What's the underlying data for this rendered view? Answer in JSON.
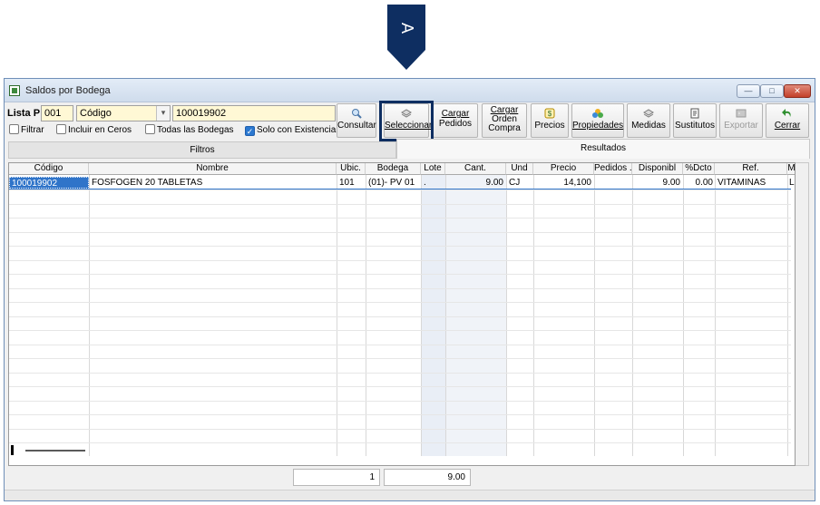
{
  "marker": {
    "letter": "A",
    "color": "#0e2e61"
  },
  "window": {
    "title": "Saldos por Bodega",
    "controls": {
      "minimize": "—",
      "maximize": "□",
      "close": "✕"
    }
  },
  "toolbar": {
    "lista_label": "Lista P:",
    "lista_value": "001",
    "criterio_value": "Código",
    "codigo_value": "100019902",
    "checkboxes": {
      "filtrar": {
        "label": "Filtrar",
        "checked": false
      },
      "incluir_ceros": {
        "label": "Incluir en Ceros",
        "checked": false
      },
      "todas_bodegas": {
        "label": "Todas las Bodegas",
        "checked": false
      },
      "solo_existencia": {
        "label": "Solo con Existencia",
        "checked": true
      }
    },
    "buttons": {
      "consultar": "Consultar",
      "seleccionar": "Seleccionar",
      "cargar_pedidos_1": "Cargar",
      "cargar_pedidos_2": "Pedidos",
      "cargar_orden_1": "Cargar",
      "cargar_orden_2": "Orden",
      "cargar_orden_3": "Compra",
      "precios": "Precios",
      "propiedades": "Propiedades",
      "medidas": "Medidas",
      "sustitutos": "Sustitutos",
      "exportar": "Exportar",
      "cerrar": "Cerrar"
    }
  },
  "tabs": {
    "filtros": "Filtros",
    "resultados": "Resultados"
  },
  "grid": {
    "columns": [
      "Código",
      "Nombre",
      "Ubic.",
      "Bodega",
      "Lote",
      "Cant.",
      "Und",
      "Precio",
      "Pedidos ...",
      "Disponibl",
      "%Dcto",
      "Ref.",
      "M"
    ],
    "rows": [
      {
        "codigo": "100019902",
        "nombre": "FOSFOGEN 20 TABLETAS",
        "ubic": "101",
        "bodega": "(01)- PV 01",
        "lote": ".",
        "cant": "9.00",
        "und": "CJ",
        "precio": "14,100",
        "pedidos": "",
        "disponible": "9.00",
        "dcto": "0.00",
        "ref": "VITAMINAS",
        "m": "L"
      }
    ]
  },
  "totals": {
    "count": "1",
    "cant": "9.00"
  }
}
